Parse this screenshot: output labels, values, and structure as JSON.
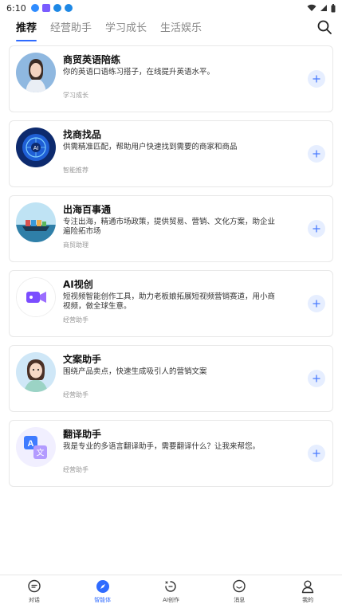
{
  "status_bar": {
    "time": "6:10",
    "icons": [
      "notification-icon",
      "app-icon",
      "download-icon",
      "mail-icon"
    ]
  },
  "tabs": [
    {
      "label": "推荐",
      "active": true
    },
    {
      "label": "经营助手",
      "active": false
    },
    {
      "label": "学习成长",
      "active": false
    },
    {
      "label": "生活娱乐",
      "active": false
    }
  ],
  "cards": [
    {
      "title": "商贸英语陪练",
      "desc": "你的英语口语练习搭子，在线提升英语水平。",
      "tag": "学习成长",
      "icon": "woman-portrait-avatar"
    },
    {
      "title": "找商找品",
      "desc": "供需精准匹配，帮助用户快速找到需要的商家和商品",
      "tag": "智能推荐",
      "icon": "ai-globe-avatar"
    },
    {
      "title": "出海百事通",
      "desc": "专注出海，精通市场政策，提供贸易、营销、文化方案，助企业遍险拓市场",
      "tag": "商贸助理",
      "icon": "cargo-ship-avatar"
    },
    {
      "title": "AI视创",
      "desc": "短视频智能创作工具，助力老板娘拓展短视频营销赛道，用小商视频，做全球生意。",
      "tag": "经营助手",
      "icon": "video-camera-avatar"
    },
    {
      "title": "文案助手",
      "desc": "围绕产品卖点，快速生成吸引人的营销文案",
      "tag": "经营助手",
      "icon": "cartoon-woman-avatar"
    },
    {
      "title": "翻译助手",
      "desc": "我是专业的多语言翻译助手，需要翻译什么？让我来帮您。",
      "tag": "经营助手",
      "icon": "translate-avatar"
    }
  ],
  "bottom_nav": [
    {
      "label": "对话",
      "icon": "chat-icon",
      "active": false
    },
    {
      "label": "智能体",
      "icon": "compass-icon",
      "active": true
    },
    {
      "label": "AI创作",
      "icon": "ai-create-icon",
      "active": false
    },
    {
      "label": "消息",
      "icon": "message-icon",
      "active": false
    },
    {
      "label": "我的",
      "icon": "profile-icon",
      "active": false
    }
  ],
  "colors": {
    "accent": "#2f6bff",
    "add_button_bg": "#e6eeff",
    "card_border": "#e8e8e8"
  }
}
